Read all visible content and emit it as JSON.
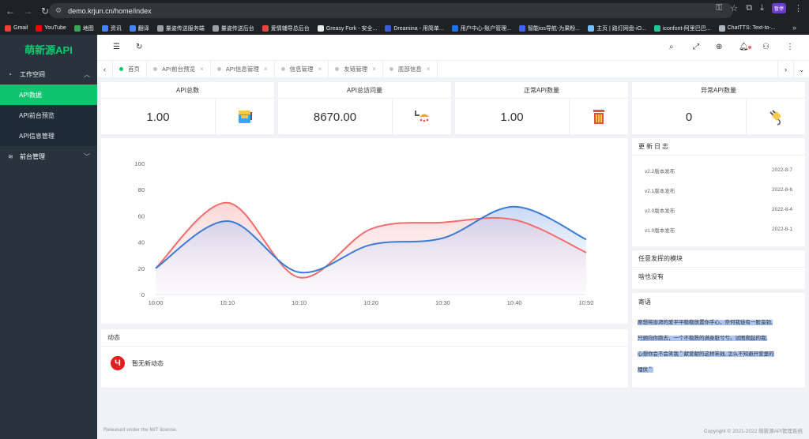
{
  "browser": {
    "url": "demo.krjun.cn/home/index",
    "ext_badge": "暂停",
    "bookmarks": [
      {
        "label": "Gmail",
        "color": "#ea4335"
      },
      {
        "label": "YouTube",
        "color": "#ff0000"
      },
      {
        "label": "地图",
        "color": "#34a853"
      },
      {
        "label": "资讯",
        "color": "#4285f4"
      },
      {
        "label": "翻译",
        "color": "#4285f4"
      },
      {
        "label": "量姿传送服务端",
        "color": "#9aa0a6"
      },
      {
        "label": "量姿传送后台",
        "color": "#9aa0a6"
      },
      {
        "label": "爱情辅导总后台",
        "color": "#e8453c"
      },
      {
        "label": "Greasy Fork - 安全...",
        "color": "#e8eaed"
      },
      {
        "label": "Dreamina - 用简单...",
        "color": "#3b5bdb"
      },
      {
        "label": "用户中心-账户管理...",
        "color": "#1a73e8"
      },
      {
        "label": "智能ios导航-为果粉...",
        "color": "#4263eb"
      },
      {
        "label": "主页 | 路灯网盘-iO...",
        "color": "#74c0fc"
      },
      {
        "label": "iconfont-阿里巴巴...",
        "color": "#20c997"
      },
      {
        "label": "ChatTTS: Text-to-...",
        "color": "#adb5bd"
      }
    ]
  },
  "sidebar": {
    "logo": "萌新源API",
    "groups": [
      {
        "label": "工作空间",
        "items": [
          "API数据",
          "API前台预览",
          "API信息管理"
        ]
      },
      {
        "label": "前台管理"
      }
    ]
  },
  "tabs": [
    "首页",
    "API前台预览",
    "API信息管理",
    "信息管理",
    "友链管理",
    "底部信息"
  ],
  "stats": [
    {
      "title": "API总数",
      "value": "1.00"
    },
    {
      "title": "API总访问量",
      "value": "8670.00"
    },
    {
      "title": "正常API数量",
      "value": "1.00"
    },
    {
      "title": "异常API数量",
      "value": "0"
    }
  ],
  "chart_data": {
    "type": "area",
    "x": [
      "10:00",
      "10:10",
      "10:10",
      "10:20",
      "10:30",
      "10:40",
      "10:50"
    ],
    "ylim": [
      0,
      100
    ],
    "yticks": [
      0,
      20,
      40,
      60,
      80,
      100
    ],
    "series": [
      {
        "values": [
          20,
          70,
          13,
          50,
          55,
          57,
          32
        ],
        "color": "#f56c6c"
      },
      {
        "values": [
          20,
          56,
          17,
          38,
          43,
          67,
          42
        ],
        "color": "#3a7bd5"
      }
    ]
  },
  "changelog": {
    "title": "更新日志",
    "items": [
      {
        "label": "v2.2版本发布",
        "date": "2022-8-7"
      },
      {
        "label": "v2.1版本发布",
        "date": "2022-8-6"
      },
      {
        "label": "v2.0版本发布",
        "date": "2022-8-4"
      },
      {
        "label": "v1.0版本发布",
        "date": "2022-8-1"
      }
    ]
  },
  "tasks": {
    "title": "任意发挥的模块",
    "body": "啥也没有"
  },
  "message": {
    "title": "寄语",
    "lines": [
      "原想将澎湃的爱平平稳稳放置你手心，奈何我徒有一股蛮劲,",
      "只顾向你跑去，一个不稳跌的满身脏兮兮。试图爬起的我,",
      "心想你会不会笑我＂献爱献的这样笨拙, 怎么不知避开爱里的",
      "埋伏＂"
    ]
  },
  "activity": {
    "title": "动态",
    "empty": "暂无新动态"
  },
  "footer": {
    "left": "Released under the MIT license.",
    "right": "Copyright © 2021-2022 萌新源API管理系统"
  }
}
